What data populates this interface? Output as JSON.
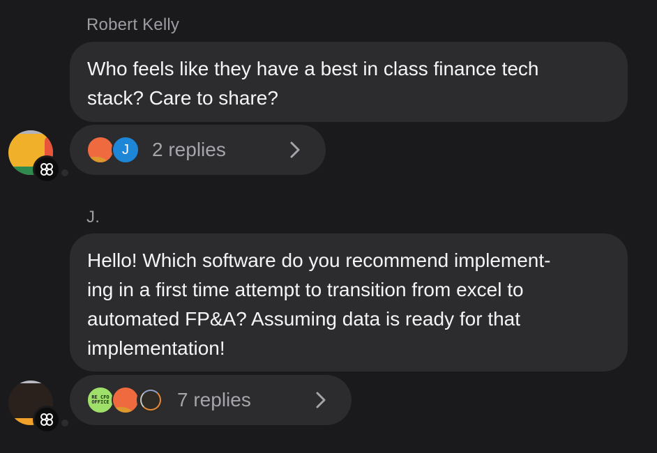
{
  "messages": [
    {
      "sender": "Robert Kelly",
      "lines": [
        "Who feels like they have a best in class finance tech",
        "stack? Care to share?"
      ],
      "replies_label": "2 replies",
      "reply_avatars": [
        {
          "kind": "orange",
          "initial": ""
        },
        {
          "kind": "blue",
          "initial": "J"
        }
      ]
    },
    {
      "sender": "J.",
      "lines": [
        "Hello! Which software do you recommend implement-",
        "ing in a first time attempt to transition from excel to",
        "automated FP&A? Assuming data is ready for that",
        "implementation!"
      ],
      "replies_label": "7 replies",
      "reply_avatars": [
        {
          "kind": "green",
          "text": "RE CFO OFFICE"
        },
        {
          "kind": "orange",
          "initial": ""
        },
        {
          "kind": "dark",
          "initial": ""
        }
      ]
    }
  ],
  "icons": {
    "community_badge": "community-badge-icon",
    "chevron": "chevron-right-icon"
  },
  "colors": {
    "background": "#1a1a1c",
    "bubble": "#2c2c2e",
    "sender": "#9d9da2",
    "muted": "#a5a5aa",
    "blue_avatar": "#1e86d6"
  }
}
